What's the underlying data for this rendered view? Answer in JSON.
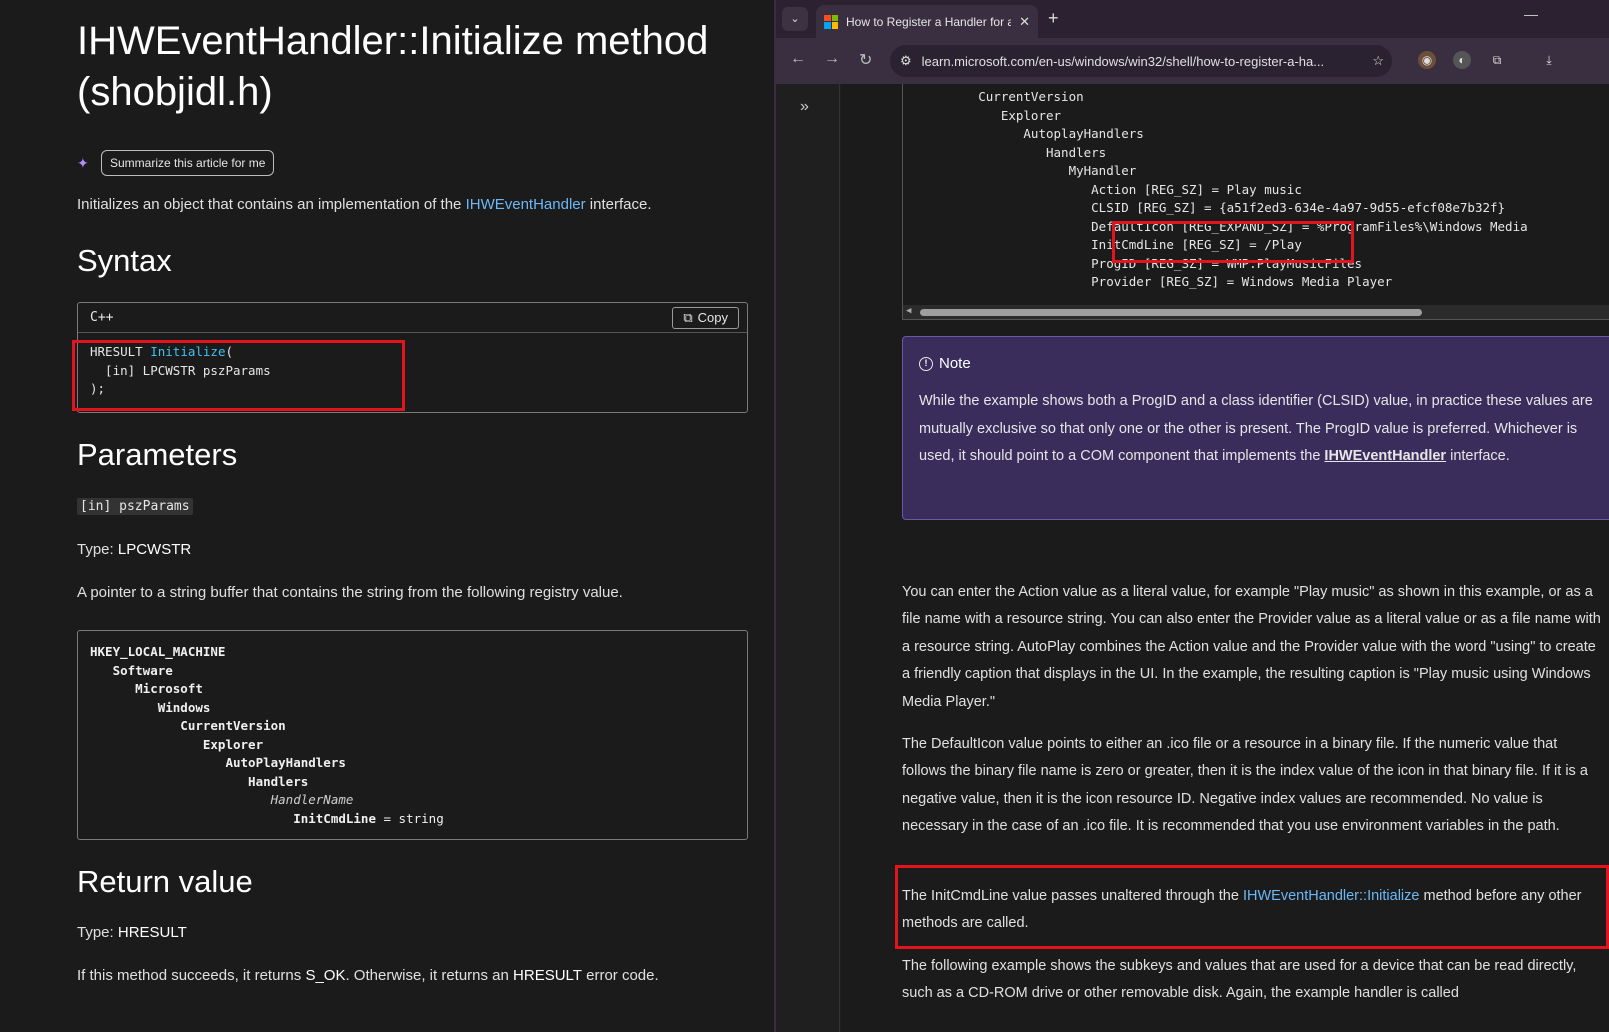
{
  "left": {
    "title": "IHWEventHandler::Initialize method (shobjidl.h)",
    "summarize_label": "Summarize this article for me",
    "lead_prefix": "Initializes an object that contains an implementation of the ",
    "lead_link": "IHWEventHandler",
    "lead_suffix": " interface.",
    "syntax_heading": "Syntax",
    "code_lang": "C++",
    "copy_label": "Copy",
    "code_ret": "HRESULT ",
    "code_func": "Initialize",
    "code_paren": "(",
    "code_line2": "  [in] LPCWSTR pszParams",
    "code_line3": ");",
    "params_heading": "Parameters",
    "param_name": "[in] pszParams",
    "type_label": "Type: ",
    "type_value": "LPCWSTR",
    "param_desc": "A pointer to a string buffer that contains the string from the following registry value.",
    "registry": [
      {
        "text": "HKEY_LOCAL_MACHINE",
        "indent": 0
      },
      {
        "text": "Software",
        "indent": 3
      },
      {
        "text": "Microsoft",
        "indent": 6
      },
      {
        "text": "Windows",
        "indent": 9
      },
      {
        "text": "CurrentVersion",
        "indent": 12
      },
      {
        "text": "Explorer",
        "indent": 15
      },
      {
        "text": "AutoPlayHandlers",
        "indent": 18
      },
      {
        "text": "Handlers",
        "indent": 21
      },
      {
        "text": "HandlerName",
        "indent": 24
      },
      {
        "text": "InitCmdLine",
        "indent": 27
      }
    ],
    "reg_value_suffix": " = string",
    "return_heading": "Return value",
    "ret_type_label": "Type: ",
    "ret_type_value": "HRESULT",
    "ret_desc_1": "If this method succeeds, it returns ",
    "ret_desc_ok": "S_OK",
    "ret_desc_2": ". Otherwise, it returns an ",
    "ret_desc_hr": "HRESULT",
    "ret_desc_3": " error code."
  },
  "browser": {
    "tab_title": "How to Register a Handler for a",
    "url": "learn.microsoft.com/en-us/windows/win32/shell/how-to-register-a-ha...",
    "code_lines": [
      "          CurrentVersion",
      "             Explorer",
      "                AutoplayHandlers",
      "                   Handlers",
      "                      MyHandler",
      "                         Action [REG_SZ] = Play music",
      "                         CLSID [REG_SZ] = {a51f2ed3-634e-4a97-9d55-efcf08e7b32f}",
      "                         DefaultIcon [REG_EXPAND_SZ] = %ProgramFiles%\\Windows Media",
      "                         InitCmdLine [REG_SZ] = /Play",
      "                         ProgID [REG_SZ] = WMP.PlayMusicFiles",
      "                         Provider [REG_SZ] = Windows Media Player"
    ],
    "note_heading": "Note",
    "note_text": "While the example shows both a ProgID and a class identifier (CLSID) value, in practice these values are mutually exclusive so that only one or the other is present. The ProgID value is preferred. Whichever is used, it should point to a COM component that implements the ",
    "note_link": "IHWEventHandler",
    "note_suffix": " interface.",
    "para1": "You can enter the Action value as a literal value, for example \"Play music\" as shown in this example, or as a file name with a resource string. You can also enter the Provider value as a literal value or as a file name with a resource string. AutoPlay combines the Action value and the Provider value with the word \"using\" to create a friendly caption that displays in the UI. In the example, the resulting caption is \"Play music using Windows Media Player.\"",
    "para2": "The DefaultIcon value points to either an .ico file or a resource in a binary file. If the numeric value that follows the binary file name is zero or greater, then it is the index value of the icon in that binary file. If it is a negative value, then it is the icon resource ID. Negative index values are recommended. No value is necessary in the case of an .ico file. It is recommended that you use environment variables in the path.",
    "para3_prefix": "The InitCmdLine value passes unaltered through the ",
    "para3_link": "IHWEventHandler::Initialize",
    "para3_suffix": " method before any other methods are called.",
    "para4": "The following example shows the subkeys and values that are used for a device that can be read directly, such as a CD-ROM drive or other removable disk. Again, the example handler is called"
  },
  "colors": {
    "highlight": "#e3141d",
    "link": "#6cb8f6",
    "note_bg": "#3a2d5c",
    "page_bg": "#1b1b1b"
  }
}
